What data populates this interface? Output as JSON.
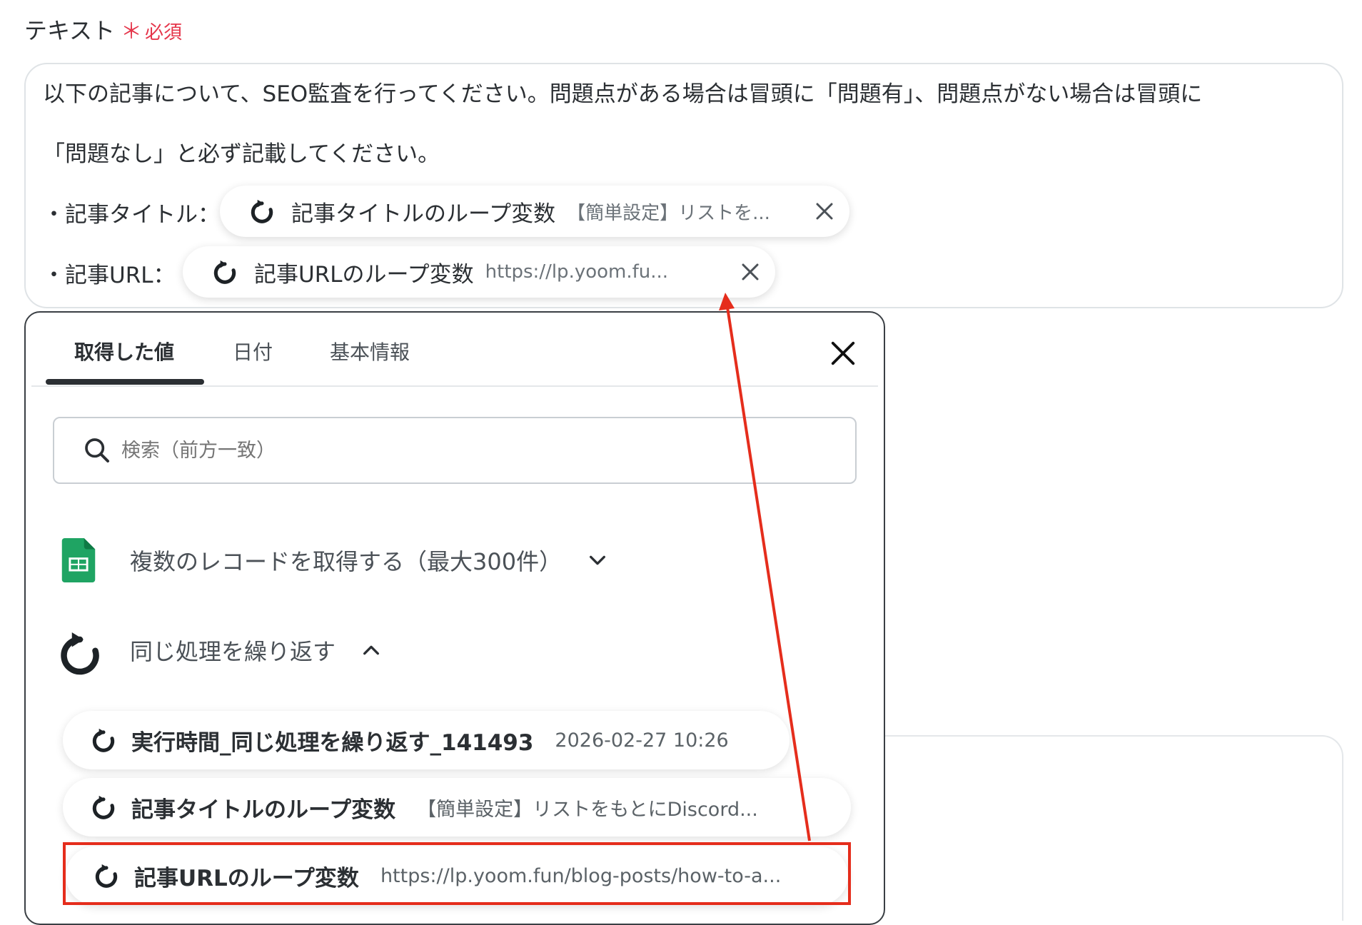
{
  "field": {
    "label": "テキスト",
    "required_star": "＊",
    "required_text": "必須"
  },
  "textarea": {
    "line1": "以下の記事について、SEO監査を行ってください。問題点がある場合は冒頭に「問題有」、問題点がない場合は冒頭に",
    "line2": "「問題なし」と必ず記載してください。",
    "bullet_title": "・記事タイトル：",
    "bullet_url": "・記事URL：",
    "chip_title": {
      "name": "記事タイトルのループ変数",
      "value": "【簡単設定】リストを..."
    },
    "chip_url": {
      "name": "記事URLのループ変数",
      "value": "https://lp.yoom.fu..."
    }
  },
  "popup": {
    "tabs": [
      {
        "label": "取得した値",
        "active": true
      },
      {
        "label": "日付",
        "active": false
      },
      {
        "label": "基本情報",
        "active": false
      }
    ],
    "search_placeholder": "検索（前方一致）",
    "groups": [
      {
        "title": "複数のレコードを取得する（最大300件）",
        "icon": "google-sheets-icon",
        "expanded": false
      },
      {
        "title": "同じ処理を繰り返す",
        "icon": "loop-icon",
        "expanded": true
      }
    ],
    "items": [
      {
        "name": "実行時間_同じ処理を繰り返す_141493",
        "value": "2026-02-27 10:26"
      },
      {
        "name": "記事タイトルのループ変数",
        "value": "【簡単設定】リストをもとにDiscord..."
      },
      {
        "name": "記事URLのループ変数",
        "value": "https://lp.yoom.fun/blog-posts/how-to-a..."
      }
    ]
  },
  "colors": {
    "required": "#e5364b",
    "annotation": "#e52d1c",
    "sheets_green": "#1fa463"
  }
}
